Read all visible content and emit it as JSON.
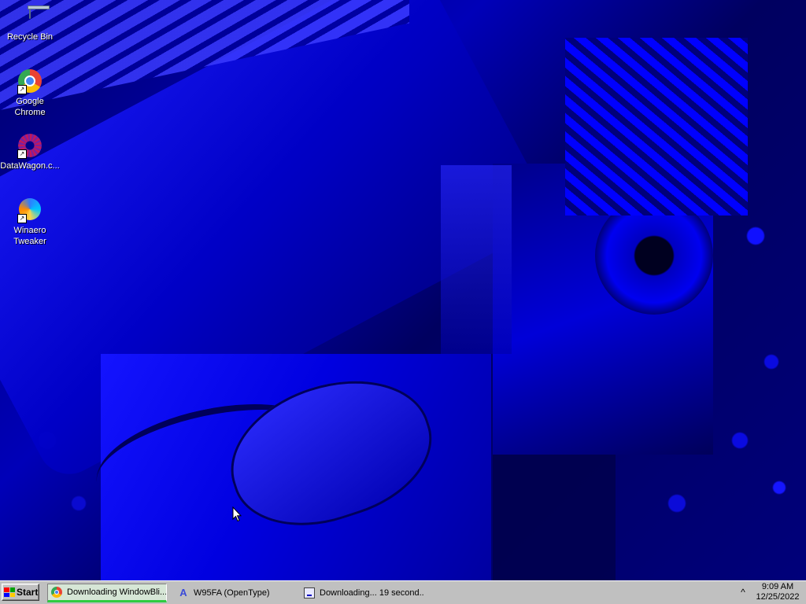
{
  "desktop": {
    "icons": [
      {
        "label": "Recycle Bin"
      },
      {
        "label": "Google Chrome"
      },
      {
        "label": "DataWagon.c..."
      },
      {
        "label": "Winaero\nTweaker"
      }
    ]
  },
  "taskbar": {
    "start_label": "Start",
    "tasks": [
      {
        "label": "Downloading WindowBli...",
        "icon": "chrome-icon",
        "active": true
      },
      {
        "label": "W95FA (OpenType)",
        "icon": "font-file-icon",
        "active": false
      },
      {
        "label": "Downloading... 19 second...",
        "icon": "download-dialog-icon",
        "active": false
      }
    ],
    "tray": {
      "chevron": "^",
      "time": "9:09 AM",
      "date": "12/25/2022"
    }
  }
}
